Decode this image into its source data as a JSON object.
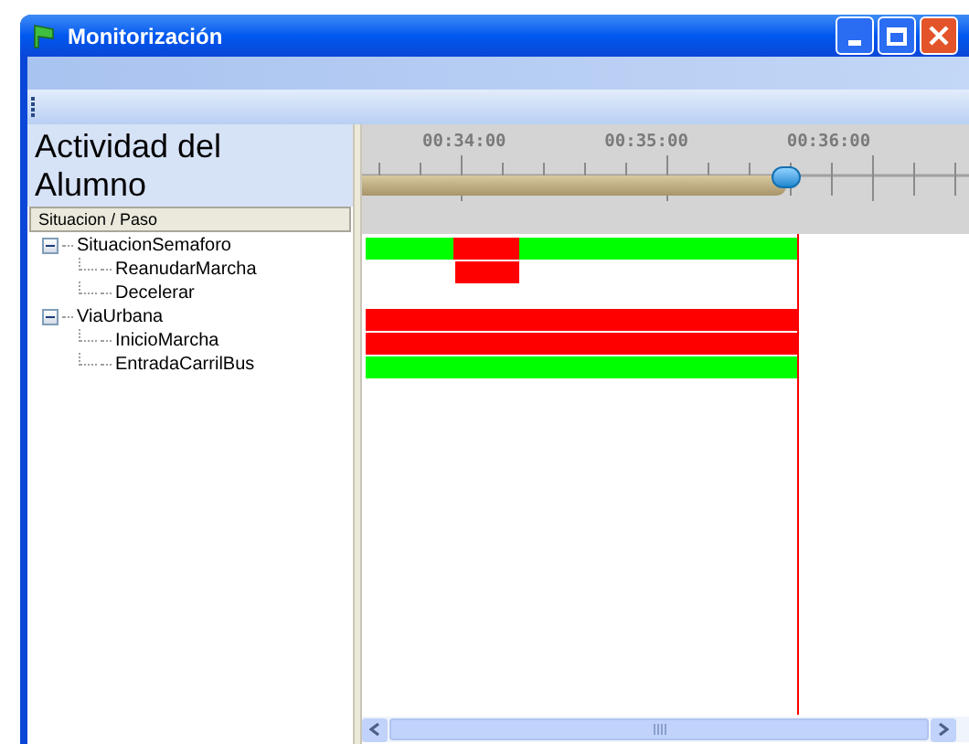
{
  "window": {
    "title": "Monitorización"
  },
  "panel_title": "Actividad del Alumno",
  "tree": {
    "column": "Situacion / Paso",
    "items": [
      {
        "label": "SituacionSemaforo",
        "expanded": true,
        "children": [
          {
            "label": "ReanudarMarcha"
          },
          {
            "label": "Decelerar"
          }
        ]
      },
      {
        "label": "ViaUrbana",
        "expanded": true,
        "children": [
          {
            "label": "InicioMarcha"
          },
          {
            "label": "EntradaCarrilBus"
          }
        ]
      }
    ]
  },
  "timeline": {
    "ticks": [
      "00:34:00",
      "00:35:00",
      "00:36:00"
    ],
    "level": 0.7
  },
  "gantt": {
    "rows": [
      {
        "segments": [
          {
            "color": "#00ff00"
          },
          {
            "color": "#ff0000"
          },
          {
            "color": "#00ff00"
          }
        ]
      },
      {
        "segments": [
          {
            "color": "#ff0000"
          }
        ]
      },
      {
        "segments": []
      },
      {
        "segments": [
          {
            "color": "#ff0000"
          }
        ]
      },
      {
        "segments": [
          {
            "color": "#ff0000"
          }
        ]
      },
      {
        "segments": [
          {
            "color": "#00ff00"
          }
        ]
      }
    ]
  }
}
